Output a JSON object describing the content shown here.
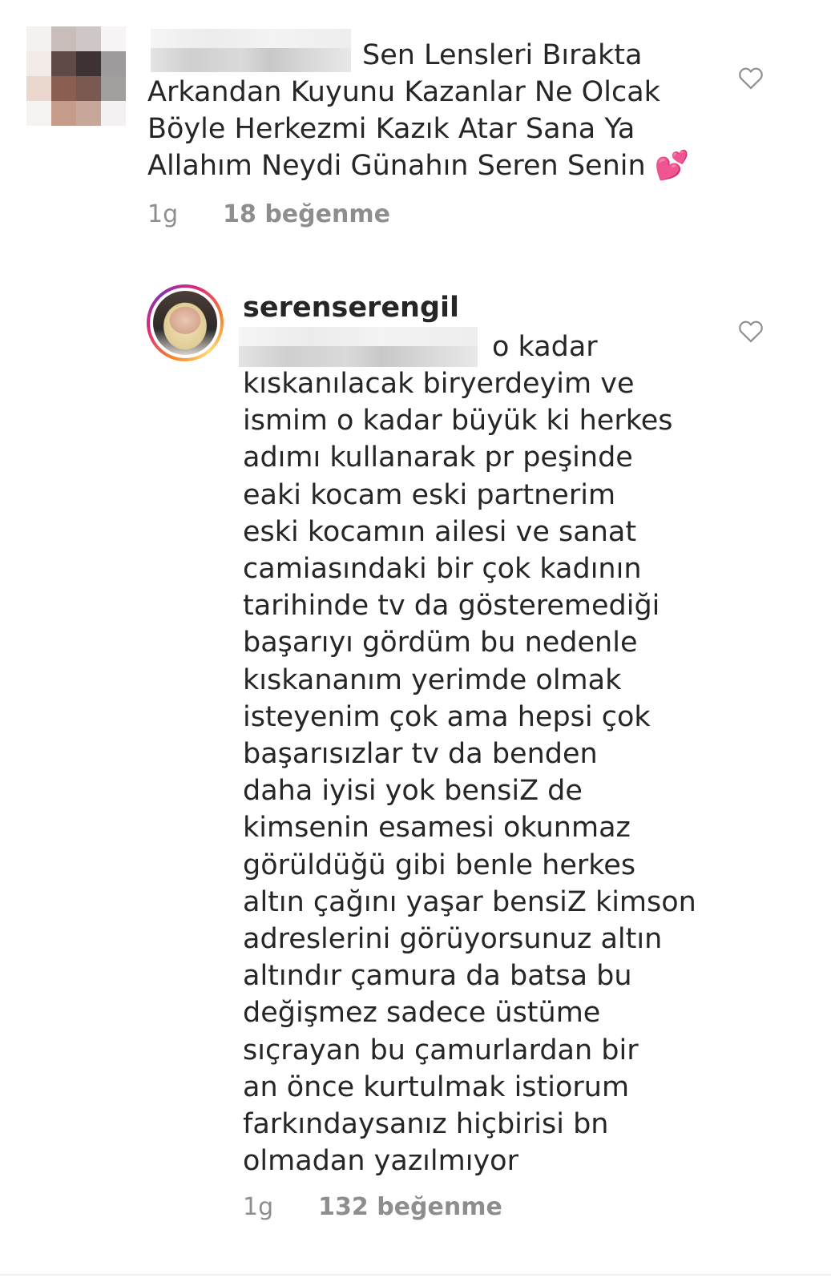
{
  "comments": [
    {
      "username": "",
      "text_line1": "Sen Lensleri Bırakta",
      "text_rest": "Arkandan Kuyunu Kazanlar Ne Olcak\nBöyle Herkezmi Kazık Atar Sana Ya\nAllahım Neydi Günahın Seren Senin",
      "emoji": "💕",
      "time": "1g",
      "likes": "18 beğenme",
      "like_icon": "heart-outline-icon"
    },
    {
      "username": "serenserengil",
      "mention": "",
      "text_line1": "o kadar",
      "text_rest": "kıskanılacak biryerdeyim ve\nismim o kadar büyük ki herkes\nadımı kullanarak pr peşinde\neaki kocam eski partnerim\neski kocamın ailesi ve sanat\ncamiasındaki bir çok kadının\ntarihinde tv da gösteremediği\nbaşarıyı gördüm bu nedenle\nkıskananım yerimde olmak\nisteyenim çok ama hepsi çok\nbaşarısızlar tv da benden\ndaha iyisi yok bensiZ de\nkimsenin esamesi okunmaz\ngörüldüğü gibi benle herkes\naltın çağını yaşar bensiZ kimson\nadreslerini görüyorsunuz altın\naltındır çamura da batsa bu\ndeğişmez sadece üstüme\nsıçrayan bu çamurlardan bir\nan önce kurtulmak istiorum\nfarkındaysanız hiçbirisi bn\nolmadan yazılmıyor",
      "time": "1g",
      "likes": "132 beğenme",
      "like_icon": "heart-outline-icon"
    }
  ],
  "colors": {
    "text": "#262626",
    "meta": "#8e8e8e",
    "icon": "#8e8e8e",
    "emoji_heart": "#e0245e"
  }
}
